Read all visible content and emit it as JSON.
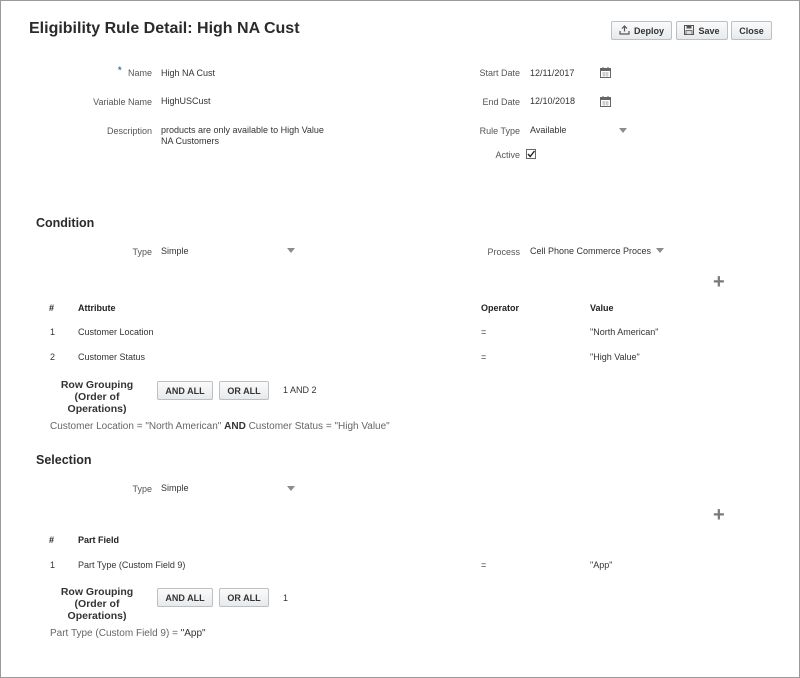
{
  "page": {
    "title": "Eligibility Rule Detail: High NA Cust"
  },
  "toolbar": {
    "deploy_label": "Deploy",
    "save_label": "Save",
    "close_label": "Close"
  },
  "form": {
    "required_marker": "*",
    "name_label": "Name",
    "name_value": "High NA Cust",
    "variable_label": "Variable Name",
    "variable_value": "HighUSCust",
    "description_label": "Description",
    "description_line1": "products are only available to High Value",
    "description_line2": "NA Customers",
    "start_label": "Start Date",
    "start_value": "12/11/2017",
    "end_label": "End Date",
    "end_value": "12/10/2018",
    "rule_type_label": "Rule Type",
    "rule_type_value": "Available",
    "active_label": "Active",
    "active_checked": true
  },
  "condition": {
    "heading": "Condition",
    "type_label": "Type",
    "type_value": "Simple",
    "process_label": "Process",
    "process_value": "Cell Phone Commerce Proces",
    "columns": {
      "num": "#",
      "attribute": "Attribute",
      "operator": "Operator",
      "value": "Value"
    },
    "rows": [
      {
        "num": "1",
        "attribute": "Customer Location",
        "operator": "=",
        "value": "\"North American\""
      },
      {
        "num": "2",
        "attribute": "Customer Status",
        "operator": "=",
        "value": "\"High Value\""
      }
    ],
    "grouping_line1": "Row Grouping",
    "grouping_line2": "(Order of Operations)",
    "and_all_label": "AND ALL",
    "or_all_label": "OR ALL",
    "grouping_value": "1 AND 2",
    "expression_part1": "Customer Location = \"North American\"",
    "expression_and": "AND",
    "expression_part2": "Customer Status = \"High Value\""
  },
  "selection": {
    "heading": "Selection",
    "type_label": "Type",
    "type_value": "Simple",
    "columns": {
      "num": "#",
      "part_field": "Part Field"
    },
    "rows": [
      {
        "num": "1",
        "field": "Part Type (Custom Field 9)",
        "operator": "=",
        "value": "\"App\""
      }
    ],
    "grouping_line1": "Row Grouping",
    "grouping_line2": "(Order of Operations)",
    "and_all_label": "AND ALL",
    "or_all_label": "OR ALL",
    "grouping_value": "1",
    "expression_part1": "Part Type (Custom Field 9) =",
    "expression_value": "\"App\""
  },
  "icons": {
    "deploy": "upload-icon",
    "save": "floppy-disk-icon",
    "calendar": "calendar-icon",
    "dropdown": "chevron-down-icon",
    "add": "plus-icon",
    "checkbox": "checkmark-icon"
  },
  "colors": {
    "required": "#1f72c4",
    "border": "#9a9a9a"
  }
}
